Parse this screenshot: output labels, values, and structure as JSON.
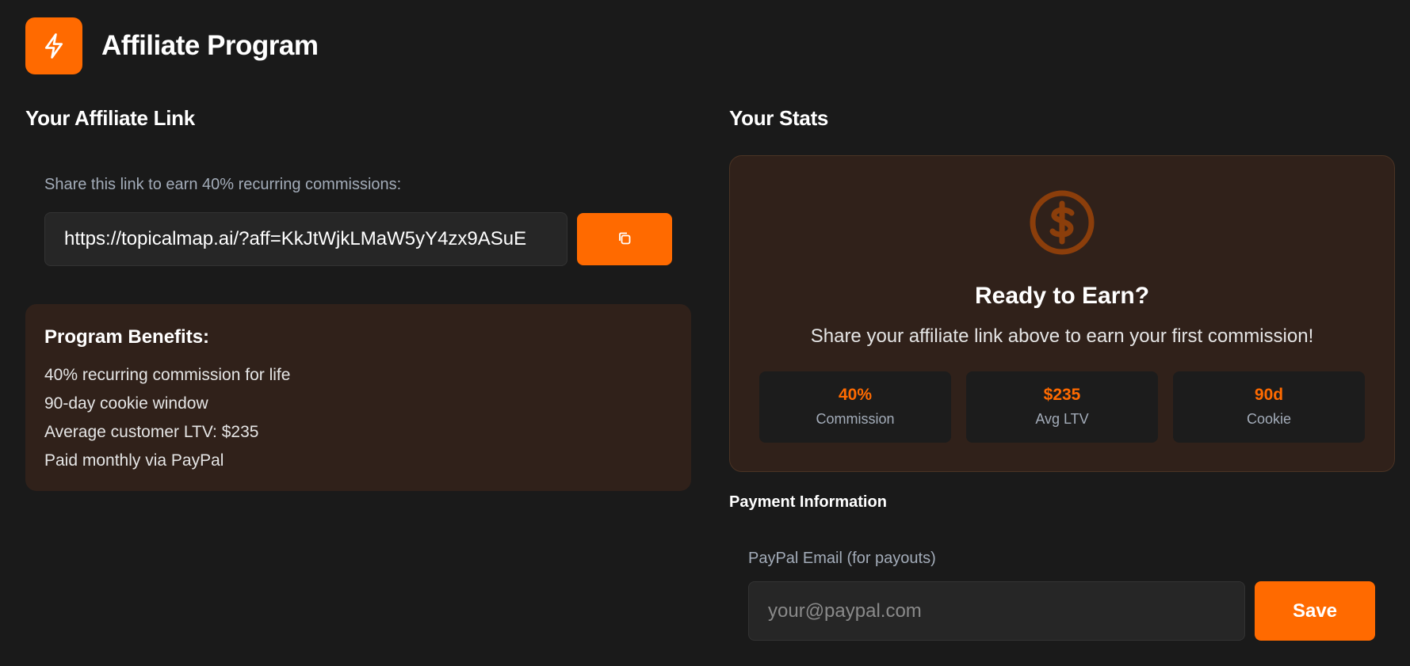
{
  "header": {
    "logo_icon": "lightning-bolt-icon",
    "title": "Affiliate Program"
  },
  "affiliate_link": {
    "section_title": "Your Affiliate Link",
    "share_label": "Share this link to earn 40% recurring commissions:",
    "link_value": "https://topicalmap.ai/?aff=KkJtWjkLMaW5yY4zx9ASuE",
    "copy_icon": "copy-icon"
  },
  "benefits": {
    "title": "Program Benefits:",
    "items": [
      "40% recurring commission for life",
      "90-day cookie window",
      "Average customer LTV: $235",
      "Paid monthly via PayPal"
    ]
  },
  "stats": {
    "section_title": "Your Stats",
    "icon": "dollar-circle-icon",
    "headline": "Ready to Earn?",
    "subtext": "Share your affiliate link above to earn your first commission!",
    "boxes": [
      {
        "value": "40%",
        "label": "Commission"
      },
      {
        "value": "$235",
        "label": "Avg LTV"
      },
      {
        "value": "90d",
        "label": "Cookie"
      }
    ]
  },
  "payment": {
    "section_title": "Payment Information",
    "email_label": "PayPal Email (for payouts)",
    "email_placeholder": "your@paypal.com",
    "email_value": "",
    "save_label": "Save"
  },
  "colors": {
    "accent": "#ff6a00",
    "background": "#1a1a1a",
    "card_brown": "#30211a",
    "icon_brown": "#8b3e0b"
  }
}
